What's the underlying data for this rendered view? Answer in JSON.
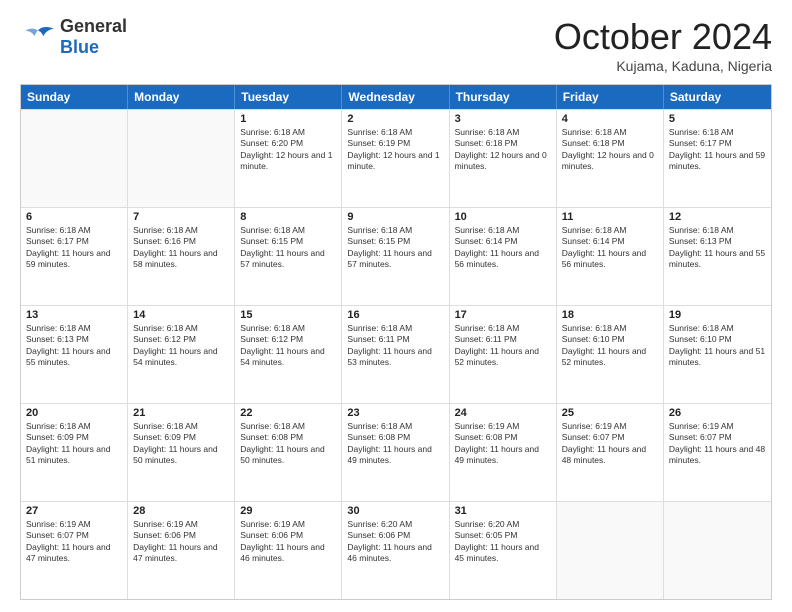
{
  "header": {
    "logo_general": "General",
    "logo_blue": "Blue",
    "month_title": "October 2024",
    "location": "Kujama, Kaduna, Nigeria"
  },
  "days_of_week": [
    "Sunday",
    "Monday",
    "Tuesday",
    "Wednesday",
    "Thursday",
    "Friday",
    "Saturday"
  ],
  "weeks": [
    [
      {
        "day": "",
        "sunrise": "",
        "sunset": "",
        "daylight": ""
      },
      {
        "day": "",
        "sunrise": "",
        "sunset": "",
        "daylight": ""
      },
      {
        "day": "1",
        "sunrise": "Sunrise: 6:18 AM",
        "sunset": "Sunset: 6:20 PM",
        "daylight": "Daylight: 12 hours and 1 minute."
      },
      {
        "day": "2",
        "sunrise": "Sunrise: 6:18 AM",
        "sunset": "Sunset: 6:19 PM",
        "daylight": "Daylight: 12 hours and 1 minute."
      },
      {
        "day": "3",
        "sunrise": "Sunrise: 6:18 AM",
        "sunset": "Sunset: 6:18 PM",
        "daylight": "Daylight: 12 hours and 0 minutes."
      },
      {
        "day": "4",
        "sunrise": "Sunrise: 6:18 AM",
        "sunset": "Sunset: 6:18 PM",
        "daylight": "Daylight: 12 hours and 0 minutes."
      },
      {
        "day": "5",
        "sunrise": "Sunrise: 6:18 AM",
        "sunset": "Sunset: 6:17 PM",
        "daylight": "Daylight: 11 hours and 59 minutes."
      }
    ],
    [
      {
        "day": "6",
        "sunrise": "Sunrise: 6:18 AM",
        "sunset": "Sunset: 6:17 PM",
        "daylight": "Daylight: 11 hours and 59 minutes."
      },
      {
        "day": "7",
        "sunrise": "Sunrise: 6:18 AM",
        "sunset": "Sunset: 6:16 PM",
        "daylight": "Daylight: 11 hours and 58 minutes."
      },
      {
        "day": "8",
        "sunrise": "Sunrise: 6:18 AM",
        "sunset": "Sunset: 6:15 PM",
        "daylight": "Daylight: 11 hours and 57 minutes."
      },
      {
        "day": "9",
        "sunrise": "Sunrise: 6:18 AM",
        "sunset": "Sunset: 6:15 PM",
        "daylight": "Daylight: 11 hours and 57 minutes."
      },
      {
        "day": "10",
        "sunrise": "Sunrise: 6:18 AM",
        "sunset": "Sunset: 6:14 PM",
        "daylight": "Daylight: 11 hours and 56 minutes."
      },
      {
        "day": "11",
        "sunrise": "Sunrise: 6:18 AM",
        "sunset": "Sunset: 6:14 PM",
        "daylight": "Daylight: 11 hours and 56 minutes."
      },
      {
        "day": "12",
        "sunrise": "Sunrise: 6:18 AM",
        "sunset": "Sunset: 6:13 PM",
        "daylight": "Daylight: 11 hours and 55 minutes."
      }
    ],
    [
      {
        "day": "13",
        "sunrise": "Sunrise: 6:18 AM",
        "sunset": "Sunset: 6:13 PM",
        "daylight": "Daylight: 11 hours and 55 minutes."
      },
      {
        "day": "14",
        "sunrise": "Sunrise: 6:18 AM",
        "sunset": "Sunset: 6:12 PM",
        "daylight": "Daylight: 11 hours and 54 minutes."
      },
      {
        "day": "15",
        "sunrise": "Sunrise: 6:18 AM",
        "sunset": "Sunset: 6:12 PM",
        "daylight": "Daylight: 11 hours and 54 minutes."
      },
      {
        "day": "16",
        "sunrise": "Sunrise: 6:18 AM",
        "sunset": "Sunset: 6:11 PM",
        "daylight": "Daylight: 11 hours and 53 minutes."
      },
      {
        "day": "17",
        "sunrise": "Sunrise: 6:18 AM",
        "sunset": "Sunset: 6:11 PM",
        "daylight": "Daylight: 11 hours and 52 minutes."
      },
      {
        "day": "18",
        "sunrise": "Sunrise: 6:18 AM",
        "sunset": "Sunset: 6:10 PM",
        "daylight": "Daylight: 11 hours and 52 minutes."
      },
      {
        "day": "19",
        "sunrise": "Sunrise: 6:18 AM",
        "sunset": "Sunset: 6:10 PM",
        "daylight": "Daylight: 11 hours and 51 minutes."
      }
    ],
    [
      {
        "day": "20",
        "sunrise": "Sunrise: 6:18 AM",
        "sunset": "Sunset: 6:09 PM",
        "daylight": "Daylight: 11 hours and 51 minutes."
      },
      {
        "day": "21",
        "sunrise": "Sunrise: 6:18 AM",
        "sunset": "Sunset: 6:09 PM",
        "daylight": "Daylight: 11 hours and 50 minutes."
      },
      {
        "day": "22",
        "sunrise": "Sunrise: 6:18 AM",
        "sunset": "Sunset: 6:08 PM",
        "daylight": "Daylight: 11 hours and 50 minutes."
      },
      {
        "day": "23",
        "sunrise": "Sunrise: 6:18 AM",
        "sunset": "Sunset: 6:08 PM",
        "daylight": "Daylight: 11 hours and 49 minutes."
      },
      {
        "day": "24",
        "sunrise": "Sunrise: 6:19 AM",
        "sunset": "Sunset: 6:08 PM",
        "daylight": "Daylight: 11 hours and 49 minutes."
      },
      {
        "day": "25",
        "sunrise": "Sunrise: 6:19 AM",
        "sunset": "Sunset: 6:07 PM",
        "daylight": "Daylight: 11 hours and 48 minutes."
      },
      {
        "day": "26",
        "sunrise": "Sunrise: 6:19 AM",
        "sunset": "Sunset: 6:07 PM",
        "daylight": "Daylight: 11 hours and 48 minutes."
      }
    ],
    [
      {
        "day": "27",
        "sunrise": "Sunrise: 6:19 AM",
        "sunset": "Sunset: 6:07 PM",
        "daylight": "Daylight: 11 hours and 47 minutes."
      },
      {
        "day": "28",
        "sunrise": "Sunrise: 6:19 AM",
        "sunset": "Sunset: 6:06 PM",
        "daylight": "Daylight: 11 hours and 47 minutes."
      },
      {
        "day": "29",
        "sunrise": "Sunrise: 6:19 AM",
        "sunset": "Sunset: 6:06 PM",
        "daylight": "Daylight: 11 hours and 46 minutes."
      },
      {
        "day": "30",
        "sunrise": "Sunrise: 6:20 AM",
        "sunset": "Sunset: 6:06 PM",
        "daylight": "Daylight: 11 hours and 46 minutes."
      },
      {
        "day": "31",
        "sunrise": "Sunrise: 6:20 AM",
        "sunset": "Sunset: 6:05 PM",
        "daylight": "Daylight: 11 hours and 45 minutes."
      },
      {
        "day": "",
        "sunrise": "",
        "sunset": "",
        "daylight": ""
      },
      {
        "day": "",
        "sunrise": "",
        "sunset": "",
        "daylight": ""
      }
    ]
  ]
}
